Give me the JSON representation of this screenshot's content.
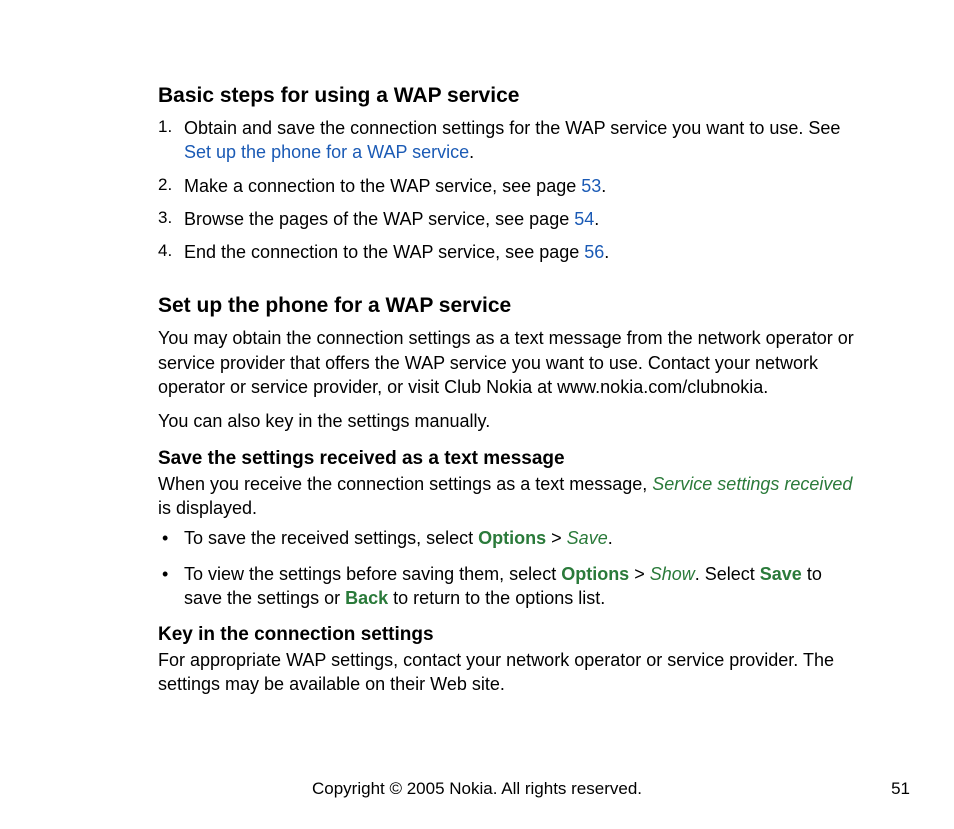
{
  "section1": {
    "heading": "Basic steps for using a WAP service",
    "steps": {
      "s1a": "Obtain and save the connection settings for the WAP service you want to use. See ",
      "s1link": "Set up the phone for a WAP service",
      "s1b": ".",
      "s2a": "Make a connection to the WAP service, see page ",
      "s2link": "53",
      "s2b": ".",
      "s3a": "Browse the pages of the WAP service, see page ",
      "s3link": "54",
      "s3b": ".",
      "s4a": "End the connection to the WAP service, see page ",
      "s4link": "56",
      "s4b": "."
    }
  },
  "section2": {
    "heading": "Set up the phone for a WAP service",
    "para1": "You may obtain the connection settings as a text message from the network operator or service provider that offers the WAP service you want to use. Contact your network operator or service provider, or visit Club Nokia at www.nokia.com/clubnokia.",
    "para2": "You can also key in the settings manually."
  },
  "section3": {
    "heading": "Save the settings received as a text message",
    "intro_a": "When you receive the connection settings as a text message, ",
    "intro_ui": "Service settings received",
    "intro_b": " is displayed.",
    "b1_a": "To save the received settings, select ",
    "b1_opt": "Options",
    "b1_gt": " > ",
    "b1_save": "Save",
    "b1_b": ".",
    "b2_a": "To view the settings before saving them, select ",
    "b2_opt": "Options",
    "b2_gt": " > ",
    "b2_show": "Show",
    "b2_b": ". Select ",
    "b2_save": "Save",
    "b2_c": " to save the settings or ",
    "b2_back": "Back",
    "b2_d": " to return to the options list."
  },
  "section4": {
    "heading": "Key in the connection settings",
    "para": "For appropriate WAP settings, contact your network operator or service provider. The settings may be available on their Web site."
  },
  "footer": {
    "copyright": "Copyright © 2005 Nokia. All rights reserved.",
    "page": "51"
  }
}
